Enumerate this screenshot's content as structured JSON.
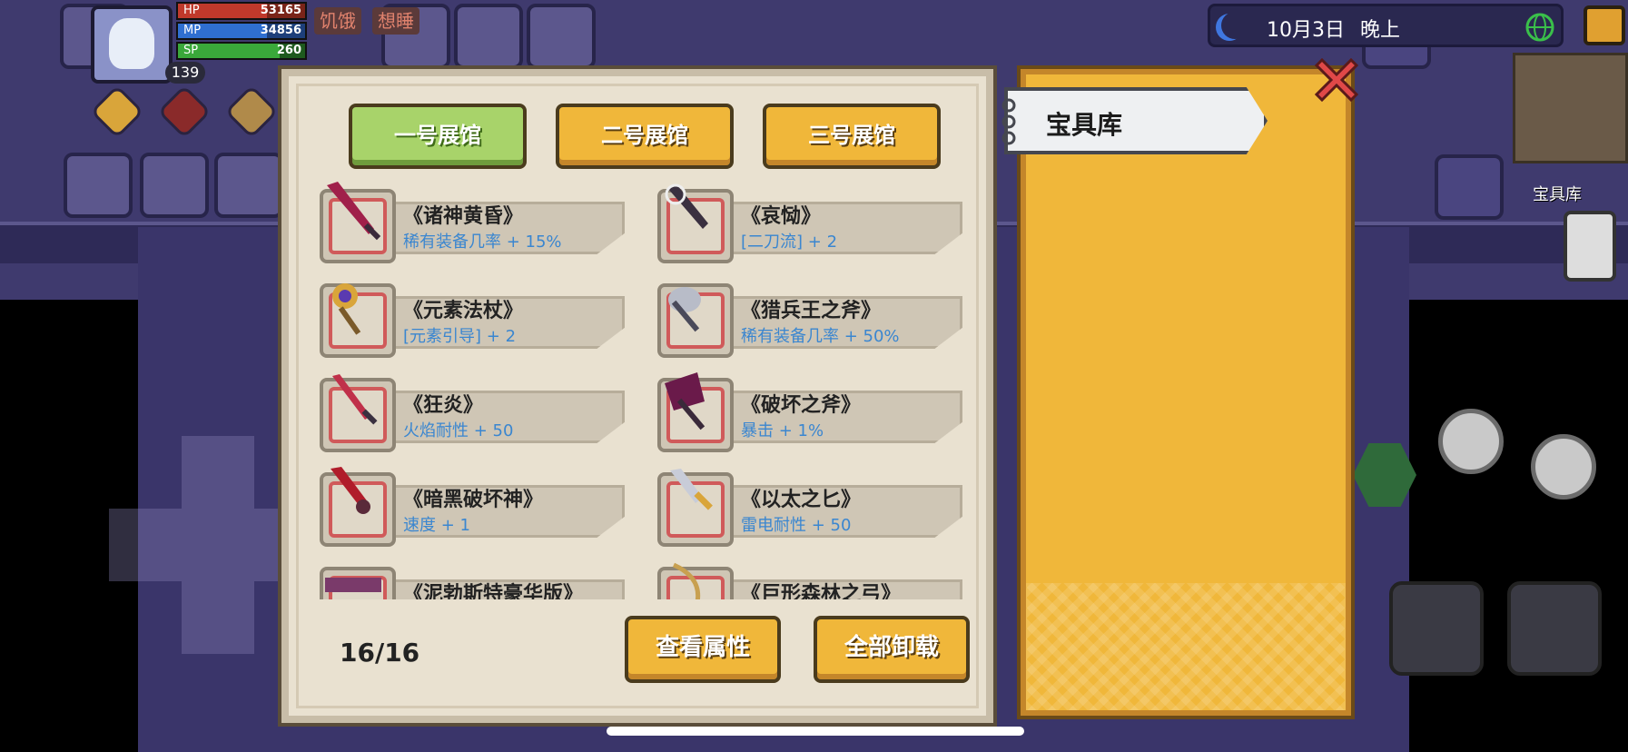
{
  "hud": {
    "level": "139",
    "hp_label": "HP",
    "hp_value": "53165",
    "mp_label": "MP",
    "mp_value": "34856",
    "sp_label": "SP",
    "sp_value": "260",
    "status_hungry": "饥饿",
    "status_sleepy": "想睡",
    "date": "10月3日",
    "time_of_day": "晚上",
    "map_location_label": "宝具库"
  },
  "panel": {
    "tabs": [
      {
        "label": "一号展馆",
        "active": true
      },
      {
        "label": "二号展馆",
        "active": false
      },
      {
        "label": "三号展馆",
        "active": false
      }
    ],
    "items": [
      {
        "name": "《诸神黄昏》",
        "effect": "稀有装备几率 + 15%",
        "icon": "crimson-greatsword-icon"
      },
      {
        "name": "《哀恸》",
        "effect": "[二刀流] + 2",
        "icon": "dark-blade-icon"
      },
      {
        "name": "《元素法杖》",
        "effect": "[元素引导] + 2",
        "icon": "elemental-staff-icon"
      },
      {
        "name": "《猎兵王之斧》",
        "effect": "稀有装备几率 + 50%",
        "icon": "hunter-axe-icon"
      },
      {
        "name": "《狂炎》",
        "effect": "火焰耐性 + 50",
        "icon": "flame-sword-icon"
      },
      {
        "name": "《破坏之斧》",
        "effect": "暴击 + 1%",
        "icon": "destruction-axe-icon"
      },
      {
        "name": "《暗黑破坏神》",
        "effect": "速度 + 1",
        "icon": "diablo-sword-icon"
      },
      {
        "name": "《以太之匕》",
        "effect": "雷电耐性 + 50",
        "icon": "ether-dagger-icon"
      },
      {
        "name": "《泥勃斯特豪华版》",
        "effect": "",
        "icon": "launcher-icon"
      },
      {
        "name": "《巨形森林之弓》",
        "effect": "",
        "icon": "forest-bow-icon"
      }
    ],
    "count": "16/16",
    "view_button": "查看属性",
    "unload_button": "全部卸载"
  },
  "vault": {
    "title": "宝具库"
  },
  "colors": {
    "accent_gold": "#f0b73a",
    "active_green": "#a8d36a",
    "effect_blue": "#3a86d0",
    "close_red": "#e04848"
  }
}
